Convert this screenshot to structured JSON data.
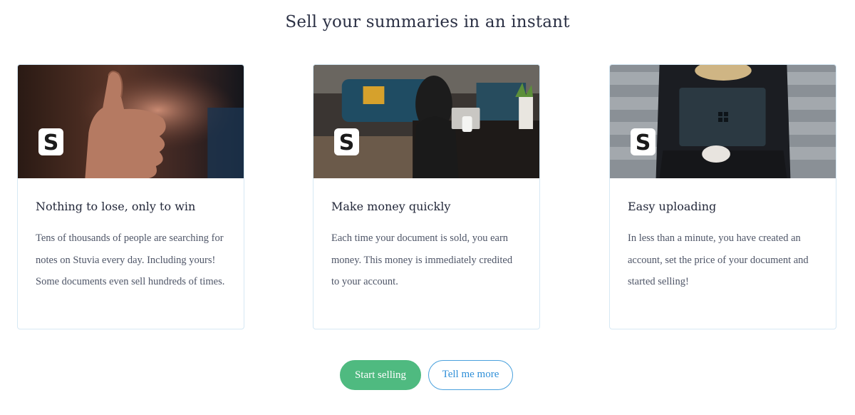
{
  "page": {
    "title": "Sell your summaries in an instant"
  },
  "logo": {
    "letter": "S"
  },
  "cards": [
    {
      "title": "Nothing to lose, only to win",
      "text": "Tens of thousands of people are searching for notes on Stuvia every day. Including yours! Some documents even sell hundreds of times.",
      "image": "thumbs-up-photo"
    },
    {
      "title": "Make money quickly",
      "text": "Each time your document is sold, you earn money. This money is immediately credited to your account.",
      "image": "woman-laptop-living-room-photo"
    },
    {
      "title": "Easy uploading",
      "text": "In less than a minute, you have created an account, set the price of your document and started selling!",
      "image": "laptop-on-lap-photo"
    }
  ],
  "actions": {
    "primary_label": "Start selling",
    "secondary_label": "Tell me more"
  },
  "colors": {
    "primary": "#4fba80",
    "link": "#2f8fd8",
    "card_border": "#d6e8f4"
  }
}
